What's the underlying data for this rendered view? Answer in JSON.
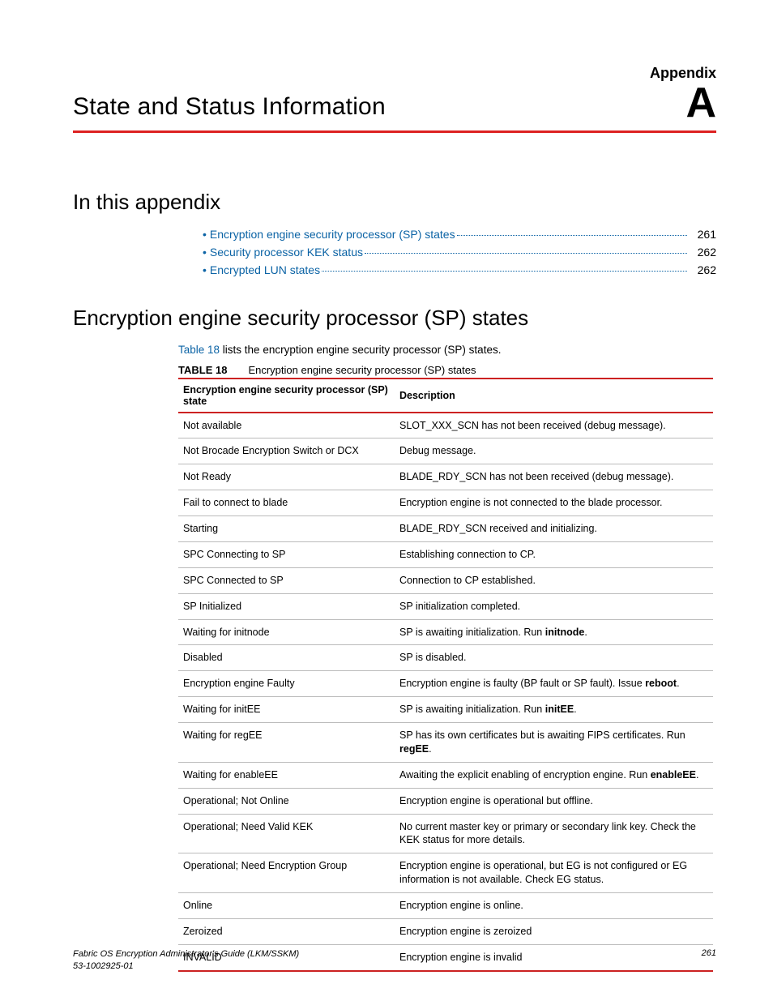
{
  "header": {
    "appendix_label": "Appendix",
    "appendix_letter": "A",
    "chapter_title": "State and Status Information"
  },
  "section1": {
    "heading": "In this appendix",
    "toc": [
      {
        "label": "Encryption engine security processor (SP) states",
        "page": "261"
      },
      {
        "label": "Security processor KEK status",
        "page": "262"
      },
      {
        "label": "Encrypted LUN states",
        "page": "262"
      }
    ]
  },
  "section2": {
    "heading": "Encryption engine security processor (SP) states",
    "intro_prefix": "Table 18",
    "intro_rest": " lists the encryption engine security processor (SP) states.",
    "table_num": "TABLE 18",
    "table_caption": "Encryption engine security processor (SP) states",
    "col1": "Encryption engine security processor (SP) state",
    "col2": "Description",
    "rows": [
      {
        "state": "Not available",
        "desc": "SLOT_XXX_SCN has not been received (debug message)."
      },
      {
        "state": "Not Brocade Encryption Switch or DCX",
        "desc": "Debug message."
      },
      {
        "state": "Not Ready",
        "desc": "BLADE_RDY_SCN has not been received (debug message)."
      },
      {
        "state": "Fail to connect to blade",
        "desc": "Encryption engine is not connected to the blade processor."
      },
      {
        "state": "Starting",
        "desc": "BLADE_RDY_SCN received and initializing."
      },
      {
        "state": "SPC Connecting to SP",
        "desc": "Establishing connection to CP."
      },
      {
        "state": "SPC Connected to SP",
        "desc": "Connection to CP established."
      },
      {
        "state": "SP Initialized",
        "desc": "SP initialization completed."
      },
      {
        "state": "Waiting for initnode",
        "desc_pre": "SP is awaiting initialization. Run ",
        "bold": "initnode",
        "desc_post": "."
      },
      {
        "state": "Disabled",
        "desc": "SP is disabled."
      },
      {
        "state": "Encryption engine Faulty",
        "desc_pre": "Encryption engine is faulty (BP fault or SP fault). Issue ",
        "bold": "reboot",
        "desc_post": "."
      },
      {
        "state": "Waiting for initEE",
        "desc_pre": "SP is awaiting initialization. Run ",
        "bold": "initEE",
        "desc_post": "."
      },
      {
        "state": "Waiting for regEE",
        "desc_pre": "SP has its own certificates but is awaiting FIPS certificates. Run ",
        "bold": "regEE",
        "desc_post": "."
      },
      {
        "state": "Waiting for enableEE",
        "desc_pre": "Awaiting the explicit enabling of encryption engine. Run ",
        "bold": "enableEE",
        "desc_post": "."
      },
      {
        "state": "Operational; Not Online",
        "desc": "Encryption engine is operational but offline."
      },
      {
        "state": "Operational; Need Valid KEK",
        "desc": "No current master key or primary or secondary link key. Check the KEK status for more details."
      },
      {
        "state": "Operational; Need Encryption Group",
        "desc": "Encryption engine is operational, but EG is not configured or EG information is not available. Check EG status."
      },
      {
        "state": "Online",
        "desc": "Encryption engine is online."
      },
      {
        "state": "Zeroized",
        "desc": "Encryption engine is zeroized"
      },
      {
        "state": "INVALID",
        "desc": "Encryption engine is invalid"
      }
    ]
  },
  "footer": {
    "line1": "Fabric OS Encryption Administrator's Guide  (LKM/SSKM)",
    "line2": "53-1002925-01",
    "page": "261"
  }
}
